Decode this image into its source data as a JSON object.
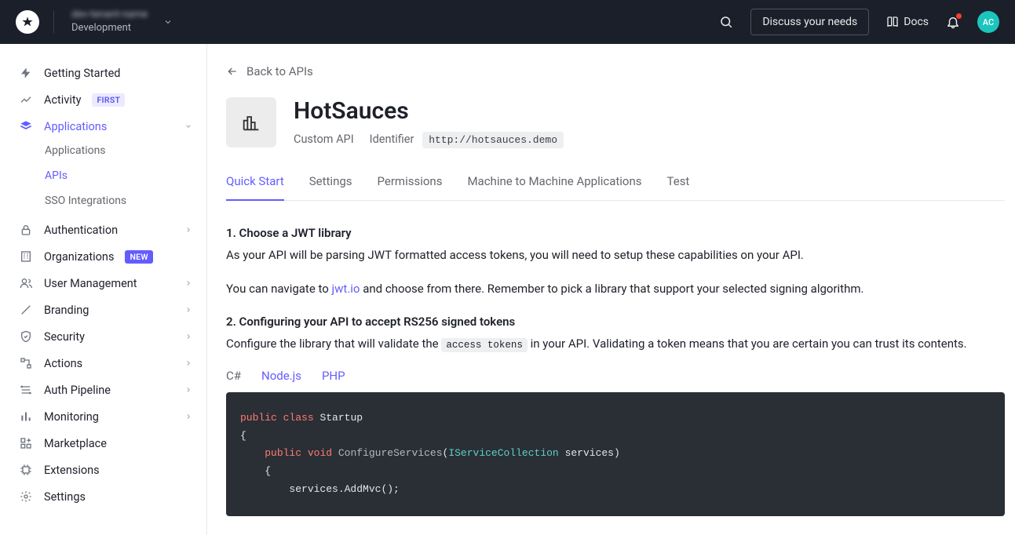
{
  "topbar": {
    "tenant_name": "dev-tenant-name",
    "tenant_env": "Development",
    "discuss_label": "Discuss your needs",
    "docs_label": "Docs",
    "avatar_initials": "AC"
  },
  "sidebar": {
    "items": [
      {
        "label": "Getting Started"
      },
      {
        "label": "Activity",
        "badge": "FIRST"
      },
      {
        "label": "Applications",
        "active": true,
        "expand": true
      },
      {
        "label": "Authentication",
        "expand": true
      },
      {
        "label": "Organizations",
        "badge": "NEW",
        "badge_style": "new"
      },
      {
        "label": "User Management",
        "expand": true
      },
      {
        "label": "Branding",
        "expand": true
      },
      {
        "label": "Security",
        "expand": true
      },
      {
        "label": "Actions",
        "expand": true
      },
      {
        "label": "Auth Pipeline",
        "expand": true
      },
      {
        "label": "Monitoring",
        "expand": true
      },
      {
        "label": "Marketplace"
      },
      {
        "label": "Extensions"
      },
      {
        "label": "Settings"
      }
    ],
    "sub_items": [
      {
        "label": "Applications"
      },
      {
        "label": "APIs",
        "active": true
      },
      {
        "label": "SSO Integrations"
      }
    ]
  },
  "main": {
    "back_label": "Back to APIs",
    "title": "HotSauces",
    "subtitle": "Custom API",
    "identifier_label": "Identifier",
    "identifier_value": "http://hotsauces.demo",
    "tabs": [
      "Quick Start",
      "Settings",
      "Permissions",
      "Machine to Machine Applications",
      "Test"
    ],
    "active_tab": 0,
    "section1_heading": "1. Choose a JWT library",
    "section1_p1": "As your API will be parsing JWT formatted access tokens, you will need to setup these capabilities on your API.",
    "section1_p2a": "You can navigate to ",
    "section1_link": "jwt.io",
    "section1_p2b": " and choose from there. Remember to pick a library that support your selected signing algorithm.",
    "section2_heading": "2. Configuring your API to accept RS256 signed tokens",
    "section2_p_a": "Configure the library that will validate the ",
    "section2_code": "access tokens",
    "section2_p_b": " in your API. Validating a token means that you are certain you can trust its contents.",
    "lang_tabs": [
      "C#",
      "Node.js",
      "PHP"
    ],
    "active_lang": 0,
    "code": {
      "l1_kw1": "public",
      "l1_kw2": "class",
      "l1_name": "Startup",
      "l2": "{",
      "l3_kw1": "public",
      "l3_kw2": "void",
      "l3_fn": "ConfigureServices",
      "l3_paren_open": "(",
      "l3_type": "IServiceCollection",
      "l3_arg": "services",
      "l3_paren_close": ")",
      "l4": "{",
      "l5": "services.AddMvc();"
    }
  }
}
